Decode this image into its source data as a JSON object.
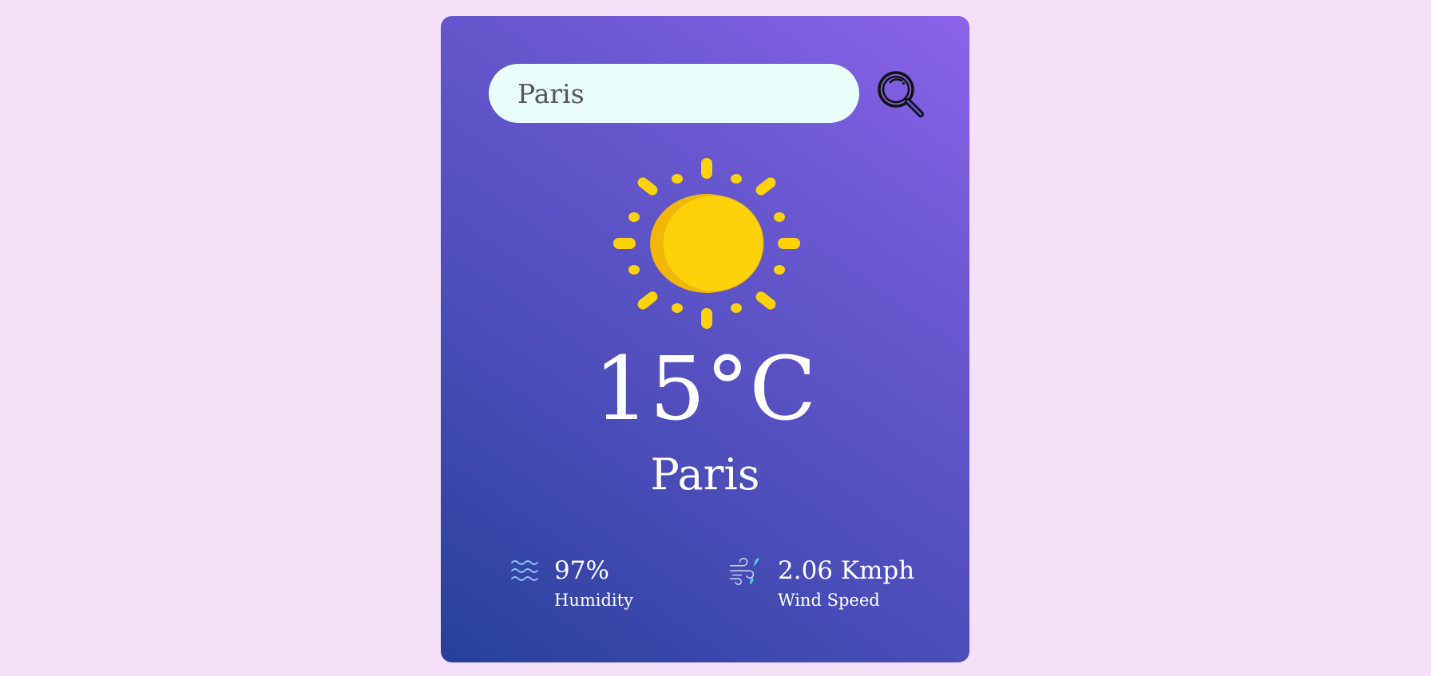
{
  "search": {
    "value": "Paris",
    "icon": "search-icon"
  },
  "weather": {
    "icon": "sun-icon",
    "temperature": "15°C",
    "city": "Paris"
  },
  "details": {
    "humidity": {
      "value": "97%",
      "label": "Humidity",
      "icon": "humidity-icon"
    },
    "wind": {
      "value": "2.06 Kmph",
      "label": "Wind Speed",
      "icon": "wind-icon"
    }
  },
  "colors": {
    "page_background": "#f5e1f7",
    "card_gradient_top": "#8b63ea",
    "card_gradient_bottom": "#26409a",
    "search_background": "#e8fdfa",
    "sun": "#fcd20a",
    "text": "#ffffff"
  }
}
